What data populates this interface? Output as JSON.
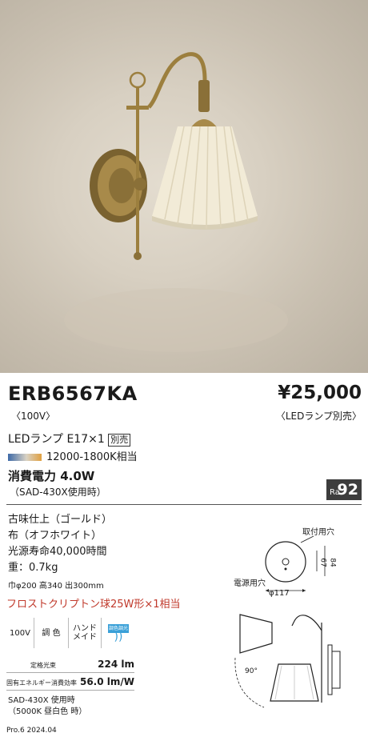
{
  "product": {
    "model": "ERB6567KA",
    "voltage": "〈100V〉",
    "price": "¥25,000",
    "price_note": "〈LEDランプ別売〉"
  },
  "lamp": {
    "type": "LEDランプ  E17×1",
    "sold_separately": "別売",
    "color_temp": "12000-1800K相当"
  },
  "power": {
    "label": "消費電力 4.0W",
    "condition": "（SAD-430X使用時）"
  },
  "ra": {
    "label": "Ra",
    "value": "92"
  },
  "details": {
    "finish": "古味仕上（ゴールド）",
    "shade": "布（オフホワイト）",
    "life": "光源寿命40,000時間",
    "weight": "重：0.7kg",
    "dimensions": "巾φ200 高340 出300mm",
    "equivalent": "フロストクリプトン球25W形×1相当"
  },
  "features": {
    "voltage": "100V",
    "dimming": "調 色",
    "handmade_line1": "ハンド",
    "handmade_line2": "メイド",
    "wireless_label": "調色調光"
  },
  "performance": {
    "flux_label": "定格光束",
    "flux_value": "224 lm",
    "efficiency_label": "固有エネルギー消費効率",
    "efficiency_value": "56.0 lm/W",
    "note_line1": "SAD-430X 使用時",
    "note_line2": "（5000K 昼白色 時）"
  },
  "diagram": {
    "mount_hole": "取付用穴",
    "power_hole": "電源用穴",
    "width": "φ117",
    "dim_67": "67",
    "dim_84": "84",
    "angle": "90°"
  },
  "footer": "Pro.6 2024.04",
  "colors": {
    "accent_red": "#c0392b",
    "ra_bg": "#3d3d3d",
    "brass": "#9c7f3e"
  }
}
